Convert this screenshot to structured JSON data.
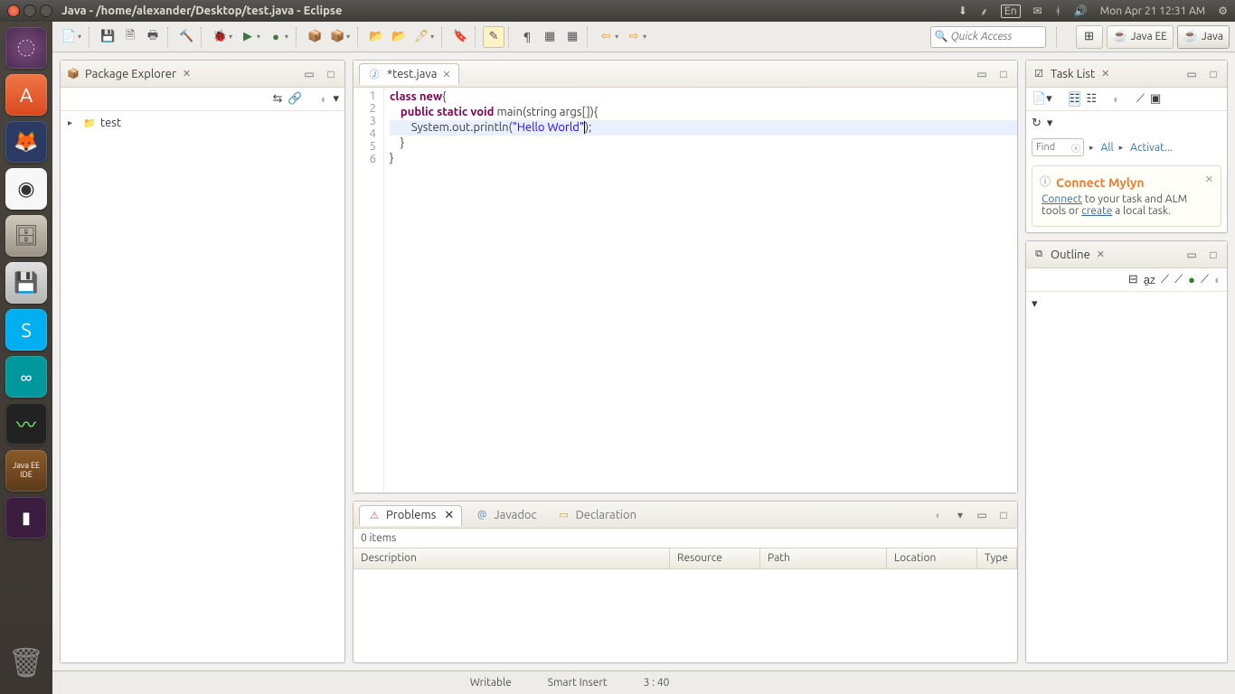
{
  "menubar": {
    "title": "Java - /home/alexander/Desktop/test.java - Eclipse",
    "indicators": {
      "lang": "En",
      "clock": "Mon Apr 21 12:31 AM"
    }
  },
  "quickAccess": {
    "placeholder": "Quick Access"
  },
  "perspectives": {
    "javaee": "Java EE",
    "java": "Java"
  },
  "packageExplorer": {
    "title": "Package Explorer",
    "items": [
      {
        "label": "test"
      }
    ]
  },
  "editor": {
    "tabLabel": "*test.java",
    "lines": [
      {
        "n": "1",
        "tokens": [
          {
            "t": "class ",
            "c": "kw"
          },
          {
            "t": "new",
            "c": "kw"
          },
          {
            "t": "{",
            "c": ""
          }
        ]
      },
      {
        "n": "2",
        "tokens": [
          {
            "t": "    ",
            "c": ""
          },
          {
            "t": "public static void ",
            "c": "kw"
          },
          {
            "t": "main(string args[]){",
            "c": ""
          }
        ]
      },
      {
        "n": "3",
        "hl": true,
        "tokens": [
          {
            "t": "        System.out.println(",
            "c": ""
          },
          {
            "t": "\"Hello World\"",
            "c": "str"
          },
          {
            "t": ");",
            "c": ""
          }
        ],
        "cursorAfter": 1
      },
      {
        "n": "4",
        "tokens": [
          {
            "t": "    }",
            "c": ""
          }
        ]
      },
      {
        "n": "5",
        "tokens": [
          {
            "t": "}",
            "c": ""
          }
        ]
      },
      {
        "n": "6",
        "tokens": [
          {
            "t": "",
            "c": ""
          }
        ]
      }
    ]
  },
  "problems": {
    "tabs": {
      "problems": "Problems",
      "javadoc": "Javadoc",
      "declaration": "Declaration"
    },
    "count": "0 items",
    "columns": [
      "Description",
      "Resource",
      "Path",
      "Location",
      "Type"
    ]
  },
  "taskList": {
    "title": "Task List",
    "find": "Find",
    "all": "All",
    "activate": "Activat..."
  },
  "mylyn": {
    "title": "Connect Mylyn",
    "link1": "Connect",
    "text1": " to your task and ALM tools or ",
    "link2": "create",
    "text2": " a local task."
  },
  "outline": {
    "title": "Outline"
  },
  "status": {
    "writable": "Writable",
    "insert": "Smart Insert",
    "pos": "3 : 40"
  }
}
